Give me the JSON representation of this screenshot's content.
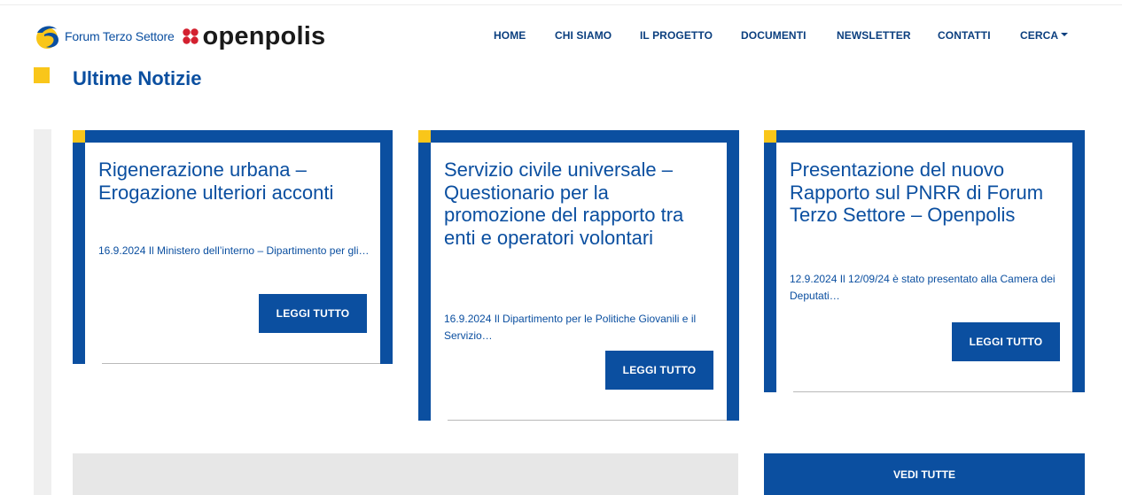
{
  "header": {
    "logo_text": "Forum Terzo Settore",
    "brand_word": "openpolis"
  },
  "nav": {
    "items": [
      {
        "label": "HOME"
      },
      {
        "label": "CHI SIAMO"
      },
      {
        "label": "IL PROGETTO"
      },
      {
        "label": "DOCUMENTI"
      },
      {
        "label": "NEWSLETTER"
      },
      {
        "label": "CONTATTI"
      },
      {
        "label": "CERCA"
      }
    ]
  },
  "section": {
    "title": "Ultime Notizie"
  },
  "cards": [
    {
      "title": "Rigenerazione urbana – Erogazione ulteriori acconti",
      "excerpt": "16.9.2024 Il Ministero dell’interno – Dipartimento per gli…",
      "button": "LEGGI TUTTO"
    },
    {
      "title": "Servizio civile universale – Questionario per la promozione del rapporto tra enti e operatori volontari",
      "excerpt": "16.9.2024 Il Dipartimento per le Politiche Giovanili e il Servizio…",
      "button": "LEGGI TUTTO"
    },
    {
      "title": "Presentazione del nuovo Rapporto sul PNRR di Forum Terzo Settore – Openpolis",
      "excerpt": "12.9.2024 Il 12/09/24 è stato presentato alla Camera dei Deputati…",
      "button": "LEGGI TUTTO"
    }
  ],
  "footer_actions": {
    "view_all": "VEDI TUTTE"
  },
  "colors": {
    "brand_blue": "#0b4fa0",
    "accent_yellow": "#f9c61a",
    "brand_red": "#d3202f"
  }
}
